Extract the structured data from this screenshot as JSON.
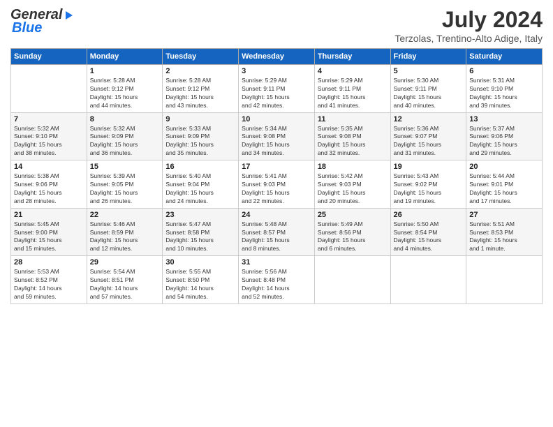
{
  "header": {
    "logo": {
      "part1": "General",
      "part2": "Blue"
    },
    "title": "July 2024",
    "subtitle": "Terzolas, Trentino-Alto Adige, Italy"
  },
  "calendar": {
    "days_of_week": [
      "Sunday",
      "Monday",
      "Tuesday",
      "Wednesday",
      "Thursday",
      "Friday",
      "Saturday"
    ],
    "weeks": [
      [
        {
          "day": "",
          "info": ""
        },
        {
          "day": "1",
          "info": "Sunrise: 5:28 AM\nSunset: 9:12 PM\nDaylight: 15 hours\nand 44 minutes."
        },
        {
          "day": "2",
          "info": "Sunrise: 5:28 AM\nSunset: 9:12 PM\nDaylight: 15 hours\nand 43 minutes."
        },
        {
          "day": "3",
          "info": "Sunrise: 5:29 AM\nSunset: 9:11 PM\nDaylight: 15 hours\nand 42 minutes."
        },
        {
          "day": "4",
          "info": "Sunrise: 5:29 AM\nSunset: 9:11 PM\nDaylight: 15 hours\nand 41 minutes."
        },
        {
          "day": "5",
          "info": "Sunrise: 5:30 AM\nSunset: 9:11 PM\nDaylight: 15 hours\nand 40 minutes."
        },
        {
          "day": "6",
          "info": "Sunrise: 5:31 AM\nSunset: 9:10 PM\nDaylight: 15 hours\nand 39 minutes."
        }
      ],
      [
        {
          "day": "7",
          "info": "Sunrise: 5:32 AM\nSunset: 9:10 PM\nDaylight: 15 hours\nand 38 minutes."
        },
        {
          "day": "8",
          "info": "Sunrise: 5:32 AM\nSunset: 9:09 PM\nDaylight: 15 hours\nand 36 minutes."
        },
        {
          "day": "9",
          "info": "Sunrise: 5:33 AM\nSunset: 9:09 PM\nDaylight: 15 hours\nand 35 minutes."
        },
        {
          "day": "10",
          "info": "Sunrise: 5:34 AM\nSunset: 9:08 PM\nDaylight: 15 hours\nand 34 minutes."
        },
        {
          "day": "11",
          "info": "Sunrise: 5:35 AM\nSunset: 9:08 PM\nDaylight: 15 hours\nand 32 minutes."
        },
        {
          "day": "12",
          "info": "Sunrise: 5:36 AM\nSunset: 9:07 PM\nDaylight: 15 hours\nand 31 minutes."
        },
        {
          "day": "13",
          "info": "Sunrise: 5:37 AM\nSunset: 9:06 PM\nDaylight: 15 hours\nand 29 minutes."
        }
      ],
      [
        {
          "day": "14",
          "info": "Sunrise: 5:38 AM\nSunset: 9:06 PM\nDaylight: 15 hours\nand 28 minutes."
        },
        {
          "day": "15",
          "info": "Sunrise: 5:39 AM\nSunset: 9:05 PM\nDaylight: 15 hours\nand 26 minutes."
        },
        {
          "day": "16",
          "info": "Sunrise: 5:40 AM\nSunset: 9:04 PM\nDaylight: 15 hours\nand 24 minutes."
        },
        {
          "day": "17",
          "info": "Sunrise: 5:41 AM\nSunset: 9:03 PM\nDaylight: 15 hours\nand 22 minutes."
        },
        {
          "day": "18",
          "info": "Sunrise: 5:42 AM\nSunset: 9:03 PM\nDaylight: 15 hours\nand 20 minutes."
        },
        {
          "day": "19",
          "info": "Sunrise: 5:43 AM\nSunset: 9:02 PM\nDaylight: 15 hours\nand 19 minutes."
        },
        {
          "day": "20",
          "info": "Sunrise: 5:44 AM\nSunset: 9:01 PM\nDaylight: 15 hours\nand 17 minutes."
        }
      ],
      [
        {
          "day": "21",
          "info": "Sunrise: 5:45 AM\nSunset: 9:00 PM\nDaylight: 15 hours\nand 15 minutes."
        },
        {
          "day": "22",
          "info": "Sunrise: 5:46 AM\nSunset: 8:59 PM\nDaylight: 15 hours\nand 12 minutes."
        },
        {
          "day": "23",
          "info": "Sunrise: 5:47 AM\nSunset: 8:58 PM\nDaylight: 15 hours\nand 10 minutes."
        },
        {
          "day": "24",
          "info": "Sunrise: 5:48 AM\nSunset: 8:57 PM\nDaylight: 15 hours\nand 8 minutes."
        },
        {
          "day": "25",
          "info": "Sunrise: 5:49 AM\nSunset: 8:56 PM\nDaylight: 15 hours\nand 6 minutes."
        },
        {
          "day": "26",
          "info": "Sunrise: 5:50 AM\nSunset: 8:54 PM\nDaylight: 15 hours\nand 4 minutes."
        },
        {
          "day": "27",
          "info": "Sunrise: 5:51 AM\nSunset: 8:53 PM\nDaylight: 15 hours\nand 1 minute."
        }
      ],
      [
        {
          "day": "28",
          "info": "Sunrise: 5:53 AM\nSunset: 8:52 PM\nDaylight: 14 hours\nand 59 minutes."
        },
        {
          "day": "29",
          "info": "Sunrise: 5:54 AM\nSunset: 8:51 PM\nDaylight: 14 hours\nand 57 minutes."
        },
        {
          "day": "30",
          "info": "Sunrise: 5:55 AM\nSunset: 8:50 PM\nDaylight: 14 hours\nand 54 minutes."
        },
        {
          "day": "31",
          "info": "Sunrise: 5:56 AM\nSunset: 8:48 PM\nDaylight: 14 hours\nand 52 minutes."
        },
        {
          "day": "",
          "info": ""
        },
        {
          "day": "",
          "info": ""
        },
        {
          "day": "",
          "info": ""
        }
      ]
    ]
  }
}
